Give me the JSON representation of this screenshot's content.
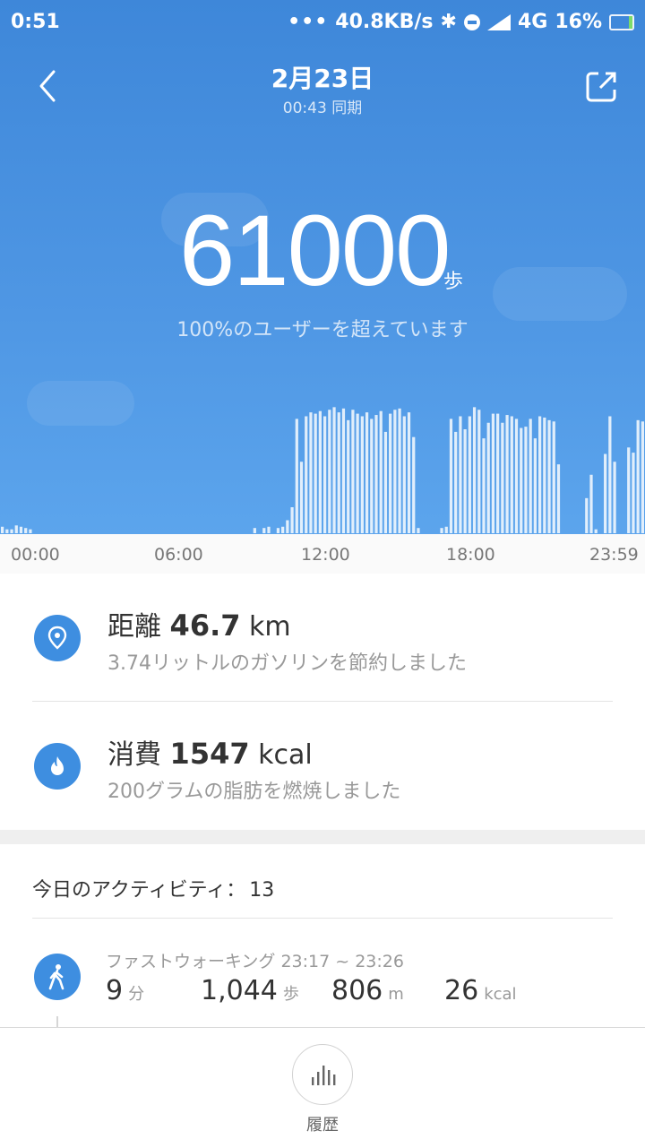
{
  "status_bar": {
    "time": "0:51",
    "network_speed": "40.8KB/s",
    "network_type": "4G",
    "battery": "16%"
  },
  "header": {
    "date": "2月23日",
    "sync": "00:43 同期"
  },
  "summary": {
    "steps": "61000",
    "steps_unit": "歩",
    "rank_text": "100%のユーザーを超えています"
  },
  "chart_data": {
    "type": "bar",
    "x_labels": [
      "00:00",
      "06:00",
      "12:00",
      "18:00",
      "23:59"
    ],
    "series_shape": "relative step activity per time slot (0 to 1)",
    "values": [
      0.05,
      0.03,
      0.03,
      0.06,
      0.05,
      0.04,
      0.03,
      0,
      0,
      0,
      0,
      0,
      0,
      0,
      0,
      0,
      0,
      0,
      0,
      0,
      0,
      0,
      0,
      0,
      0,
      0,
      0,
      0,
      0,
      0,
      0,
      0,
      0,
      0,
      0,
      0,
      0,
      0,
      0,
      0,
      0,
      0,
      0,
      0,
      0,
      0,
      0,
      0,
      0,
      0,
      0,
      0,
      0,
      0,
      0.04,
      0,
      0.04,
      0.05,
      0,
      0.04,
      0.05,
      0.1,
      0.2,
      0.88,
      0.55,
      0.9,
      0.93,
      0.92,
      0.94,
      0.9,
      0.95,
      0.97,
      0.93,
      0.96,
      0.87,
      0.95,
      0.92,
      0.9,
      0.93,
      0.88,
      0.91,
      0.94,
      0.78,
      0.92,
      0.95,
      0.96,
      0.9,
      0.93,
      0.74,
      0.04,
      0,
      0,
      0,
      0,
      0.04,
      0.05,
      0.88,
      0.78,
      0.9,
      0.8,
      0.9,
      0.97,
      0.95,
      0.73,
      0.85,
      0.92,
      0.92,
      0.85,
      0.91,
      0.9,
      0.88,
      0.81,
      0.82,
      0.88,
      0.73,
      0.9,
      0.89,
      0.87,
      0.86,
      0.53,
      0,
      0,
      0,
      0,
      0,
      0.27,
      0.45,
      0.03,
      0,
      0.61,
      0.9,
      0.55,
      0,
      0,
      0.66,
      0.62,
      0.87,
      0.86
    ]
  },
  "stats": {
    "distance": {
      "label": "距離",
      "value": "46.7",
      "unit": "km",
      "sub": "3.74リットルのガソリンを節約しました"
    },
    "calories": {
      "label": "消費",
      "value": "1547",
      "unit": "kcal",
      "sub": "200グラムの脂肪を燃焼しました"
    }
  },
  "activity": {
    "heading": "今日のアクティビティ：",
    "count": "13",
    "items": [
      {
        "title": "ファストウォーキング 23:17 ~ 23:26",
        "duration": "9",
        "duration_unit": "分",
        "steps": "1,044",
        "steps_unit": "歩",
        "distance": "806",
        "distance_unit": "m",
        "calories": "26",
        "calories_unit": "kcal"
      }
    ]
  },
  "bottom_nav": {
    "history_label": "履歴"
  },
  "colors": {
    "hero_top": "#3e87d9",
    "hero_bottom": "#5ea7ee",
    "icon_blue": "#3e8ee0"
  }
}
